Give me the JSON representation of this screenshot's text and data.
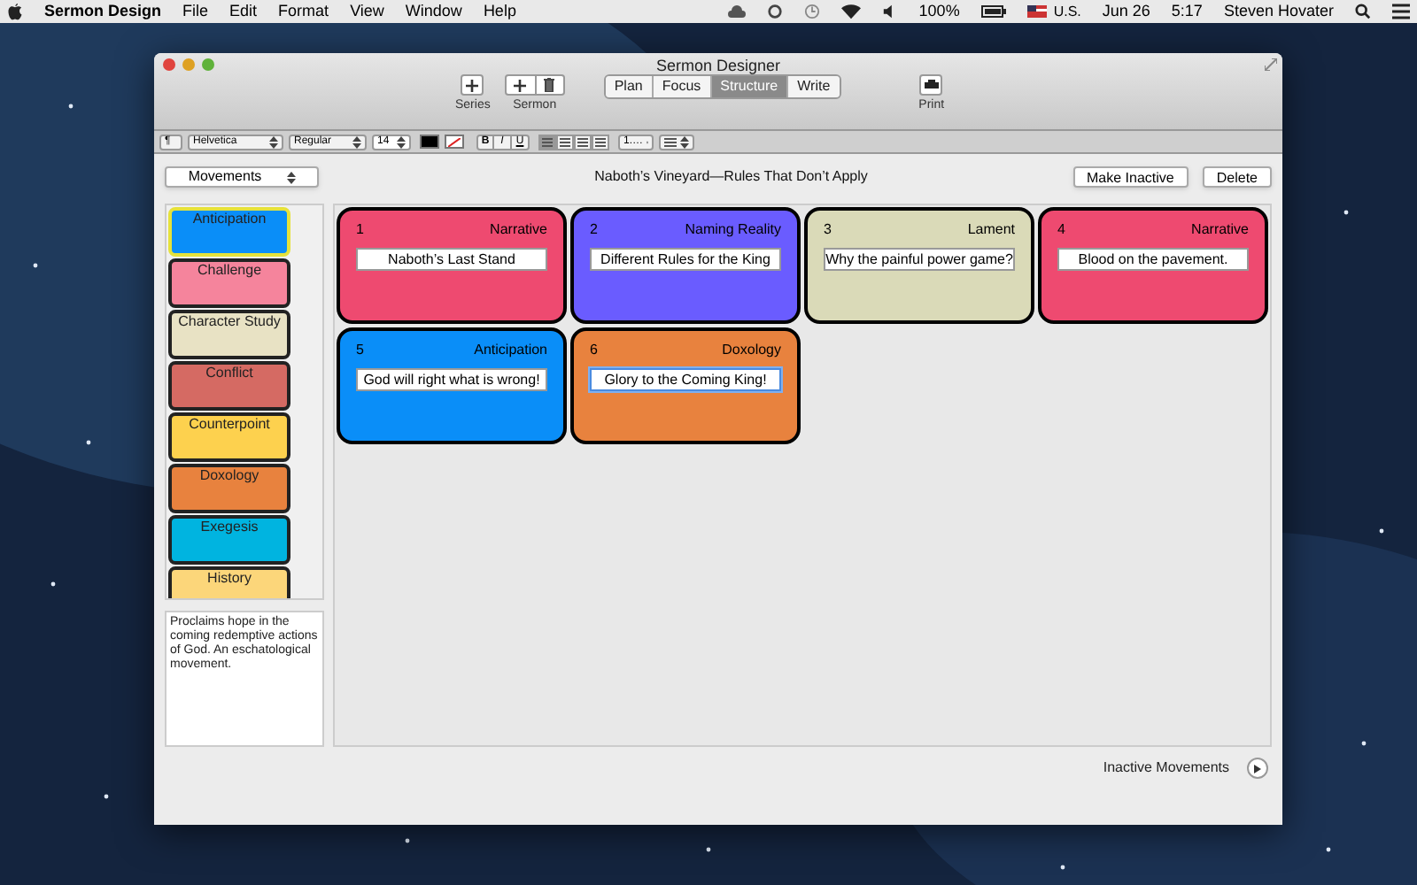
{
  "menubar": {
    "app": "Sermon Design",
    "menus": [
      "File",
      "Edit",
      "Format",
      "View",
      "Window",
      "Help"
    ],
    "battery": "100%",
    "input": "U.S.",
    "date": "Jun 26",
    "time": "5:17",
    "user": "Steven Hovater"
  },
  "window": {
    "title": "Sermon Designer"
  },
  "toolbar": {
    "series_label": "Series",
    "sermon_label": "Sermon",
    "views": [
      {
        "label": "Plan",
        "selected": false
      },
      {
        "label": "Focus",
        "selected": false
      },
      {
        "label": "Structure",
        "selected": true
      },
      {
        "label": "Write",
        "selected": false
      }
    ],
    "print_label": "Print"
  },
  "format_bar": {
    "paragraph": "¶",
    "font": "Helvetica",
    "style": "Regular",
    "size": "14",
    "bold": "B",
    "italic": "I",
    "underline": "U",
    "list": "1.…"
  },
  "header": {
    "dropdown": "Movements",
    "sermon_title": "Naboth’s Vineyard—Rules That Don’t Apply",
    "buttons": [
      "Make Inactive",
      "Delete"
    ]
  },
  "palette": [
    {
      "name": "Anticipation",
      "color": "#0a8ef8",
      "selected": true
    },
    {
      "name": "Challenge",
      "color": "#f5849c",
      "selected": false
    },
    {
      "name": "Character Study",
      "color": "#e8e2c4",
      "selected": false
    },
    {
      "name": "Conflict",
      "color": "#d56a63",
      "selected": false
    },
    {
      "name": "Counterpoint",
      "color": "#fdd14e",
      "selected": false
    },
    {
      "name": "Doxology",
      "color": "#e8823e",
      "selected": false
    },
    {
      "name": "Exegesis",
      "color": "#00b4e0",
      "selected": false
    },
    {
      "name": "History",
      "color": "#fcd67a",
      "selected": false
    }
  ],
  "description": "Proclaims hope in the coming redemptive actions of God. An eschatological movement.",
  "cards": [
    {
      "number": "1",
      "type": "Narrative",
      "title": "Naboth’s Last Stand",
      "color": "#ee4a70",
      "focused": false
    },
    {
      "number": "2",
      "type": "Naming Reality",
      "title": "Different Rules for the King",
      "color": "#6a5cff",
      "focused": false
    },
    {
      "number": "3",
      "type": "Lament",
      "title": "Why the painful power game?",
      "color": "#dadab8",
      "focused": false
    },
    {
      "number": "4",
      "type": "Narrative",
      "title": "Blood on the pavement.",
      "color": "#ee4a70",
      "focused": false
    },
    {
      "number": "5",
      "type": "Anticipation",
      "title": "God will right what is wrong!",
      "color": "#0a8ef8",
      "focused": false
    },
    {
      "number": "6",
      "type": "Doxology",
      "title": "Glory to the Coming King!",
      "color": "#e8823e",
      "focused": true
    }
  ],
  "footer": {
    "label": "Inactive Movements"
  }
}
